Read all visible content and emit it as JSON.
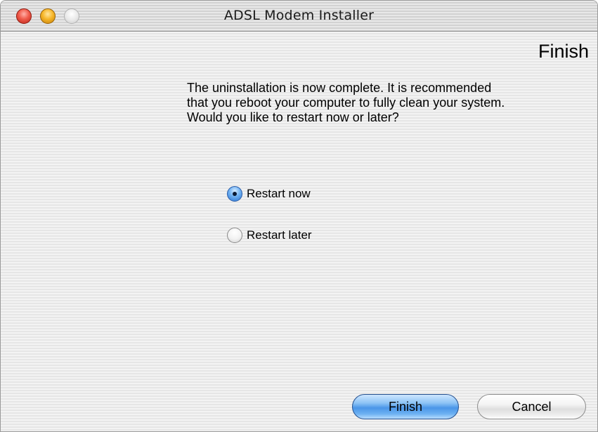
{
  "window": {
    "title": "ADSL Modem Installer"
  },
  "page": {
    "heading": "Finish",
    "message_lines": [
      "The uninstallation is now complete.  It is recommended",
      "that you reboot your computer to fully clean your system.",
      "Would you like to restart now or later?"
    ]
  },
  "options": {
    "items": [
      {
        "label": "Restart now",
        "selected": true
      },
      {
        "label": "Restart later",
        "selected": false
      }
    ]
  },
  "buttons": {
    "finish_label": "Finish",
    "cancel_label": "Cancel"
  },
  "colors": {
    "default_button": "#4a96e8",
    "close_light": "#f05a4a",
    "minimize_light": "#f6b629"
  }
}
